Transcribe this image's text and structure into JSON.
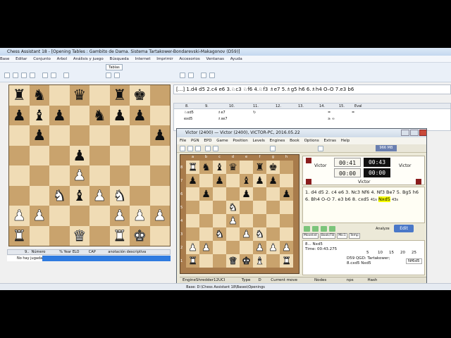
{
  "app": {
    "title": "Chess Assistant 18 - [Opening Tables : Gambito de Dama. Sistema Tartakower-Bondarevski-Makagonov (D59)]",
    "menu": [
      "Base",
      "Editar",
      "Conjunto",
      "Arbol",
      "Análisis y juego",
      "Búsqueda",
      "Internet",
      "Imprimir",
      "Accesorios",
      "Ventanas",
      "Ayuda"
    ],
    "tab_label": "Tablas",
    "notation": "[...] 1.d4 d5 2.c4 e6 3.♘c3 ♘f6 4.♘f3 ♗e7 5.♗g5 h6 6.♗h4 O–O 7.e3 b6",
    "move_table": {
      "headers": [
        "8.",
        "9.",
        "10.",
        "11.",
        "12.",
        "13.",
        "14.",
        "15.",
        "Eval"
      ],
      "row1": [
        "♘xd5",
        "♗e7",
        "↻",
        "=",
        "="
      ],
      "row2": [
        "exd5",
        "♗xe7",
        "≥ ∞"
      ]
    },
    "game_list": {
      "headers": [
        "9..",
        "Número",
        "% Year",
        "ELO",
        "CAP",
        "anotación descriptiva"
      ],
      "empty": "No hay jugadas"
    },
    "status": "Base: D:\\Chess Assistant 18\\Bases\\Openings"
  },
  "main_board": [
    [
      "bR",
      "bN",
      "",
      "bQ",
      "",
      "bR",
      "bK",
      ""
    ],
    [
      "bP",
      "bB",
      "bP",
      "",
      "bN",
      "bP",
      "bP",
      ""
    ],
    [
      "",
      "bP",
      "",
      "",
      "",
      "",
      "",
      "bP"
    ],
    [
      "",
      "",
      "",
      "bP",
      "",
      "",
      "",
      ""
    ],
    [
      "",
      "",
      "",
      "wP",
      "",
      "",
      "",
      ""
    ],
    [
      "",
      "",
      "wN",
      "bB",
      "wP",
      "wN",
      "",
      ""
    ],
    [
      "wP",
      "wP",
      "",
      "",
      "",
      "wP",
      "wP",
      "wP"
    ],
    [
      "wR",
      "",
      "",
      "wQ",
      "",
      "wR",
      "wK",
      ""
    ]
  ],
  "engine_window": {
    "title": "Victor (2400)  —  Victor (2400),  VICTOR-PC,  2016.05.22",
    "menu": [
      "File",
      "PGN",
      "EPD",
      "Game",
      "Position",
      "Levels",
      "Engines",
      "Book",
      "Options",
      "Extras",
      "Help"
    ],
    "memory": "966 MB",
    "files": [
      "a",
      "b",
      "c",
      "d",
      "e",
      "f",
      "g",
      "h"
    ],
    "ranks": [
      "8",
      "7",
      "6",
      "5",
      "4",
      "3",
      "2",
      "1"
    ],
    "player_left": "Victor",
    "player_right": "Victor",
    "clock_top_left": "00:41",
    "clock_top_right": "00:43",
    "clock_bottom_left": "00:00",
    "clock_bottom_right": "00:00",
    "moves_text": "1. d4 d5 2. c4 e6 3. Nc3 Nf6 4. Nf3 Be7 5. Bg5 h6 6. Bh4 O-O 7. e3 b6 8. cxd5",
    "move_time_1": "41s",
    "highlight_move": "Nxd5",
    "move_time_2": "43s",
    "buttons": [
      "Movelist",
      "Book/TB",
      "Mic1",
      "Temp"
    ],
    "analyze_label": "Analyze",
    "edit_label": "Edit",
    "engine_move": "8... Nxd5",
    "engine_time": "Time: 00:43.275",
    "scale": [
      "5",
      "10",
      "15",
      "20",
      "25"
    ],
    "opening": "D59 QGD: Tartakower;",
    "opening_line": "8.cxd5 Nxd5",
    "best_move": "Nf6d5",
    "engine_name": "EngineShredder12UCI",
    "columns": [
      "Type",
      "D",
      "Current move",
      "Nodes",
      "nps",
      "Hash"
    ]
  },
  "engine_board": [
    [
      "wR",
      "bN",
      "bB",
      "bQ",
      "",
      "bR",
      "bK",
      ""
    ],
    [
      "bP",
      "",
      "bP",
      "",
      "bB",
      "bP",
      "bP",
      ""
    ],
    [
      "",
      "bP",
      "",
      "",
      "bP",
      "",
      "",
      "bP"
    ],
    [
      "",
      "",
      "",
      "wN",
      "",
      "",
      "",
      ""
    ],
    [
      "",
      "",
      "",
      "wP",
      "",
      "",
      "",
      ""
    ],
    [
      "",
      "",
      "wN",
      "",
      "wP",
      "wN",
      "",
      ""
    ],
    [
      "wP",
      "wP",
      "",
      "",
      "",
      "wP",
      "wP",
      "wP"
    ],
    [
      "wR",
      "",
      "",
      "wQ",
      "wK",
      "wB",
      "",
      "wR"
    ]
  ]
}
